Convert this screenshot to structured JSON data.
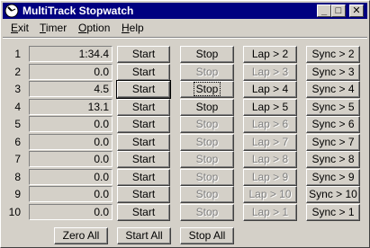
{
  "window": {
    "title": "MultiTrack Stopwatch"
  },
  "title_buttons": {
    "minimize": "_",
    "maximize": "□",
    "close": "✕"
  },
  "menu": [
    {
      "mnemonic": "E",
      "rest": "xit"
    },
    {
      "mnemonic": "T",
      "rest": "imer"
    },
    {
      "mnemonic": "O",
      "rest": "ption"
    },
    {
      "mnemonic": "H",
      "rest": "elp"
    }
  ],
  "rows": [
    {
      "num": "1",
      "time": "1:34.4",
      "start": "Start",
      "stop": "Stop",
      "lap": "Lap > 2",
      "sync": "Sync > 2",
      "start_enabled": true,
      "stop_enabled": true,
      "lap_enabled": true,
      "sync_enabled": true
    },
    {
      "num": "2",
      "time": "0.0",
      "start": "Start",
      "stop": "Stop",
      "lap": "Lap > 3",
      "sync": "Sync > 3",
      "start_enabled": true,
      "stop_enabled": false,
      "lap_enabled": false,
      "sync_enabled": true
    },
    {
      "num": "3",
      "time": "4.5",
      "start": "Start",
      "stop": "Stop",
      "lap": "Lap > 4",
      "sync": "Sync > 4",
      "start_enabled": true,
      "stop_enabled": true,
      "lap_enabled": true,
      "sync_enabled": true
    },
    {
      "num": "4",
      "time": "13.1",
      "start": "Start",
      "stop": "Stop",
      "lap": "Lap > 5",
      "sync": "Sync > 5",
      "start_enabled": true,
      "stop_enabled": true,
      "lap_enabled": true,
      "sync_enabled": true
    },
    {
      "num": "5",
      "time": "0.0",
      "start": "Start",
      "stop": "Stop",
      "lap": "Lap > 6",
      "sync": "Sync > 6",
      "start_enabled": true,
      "stop_enabled": false,
      "lap_enabled": false,
      "sync_enabled": true
    },
    {
      "num": "6",
      "time": "0.0",
      "start": "Start",
      "stop": "Stop",
      "lap": "Lap > 7",
      "sync": "Sync > 7",
      "start_enabled": true,
      "stop_enabled": false,
      "lap_enabled": false,
      "sync_enabled": true
    },
    {
      "num": "7",
      "time": "0.0",
      "start": "Start",
      "stop": "Stop",
      "lap": "Lap > 8",
      "sync": "Sync > 8",
      "start_enabled": true,
      "stop_enabled": false,
      "lap_enabled": false,
      "sync_enabled": true
    },
    {
      "num": "8",
      "time": "0.0",
      "start": "Start",
      "stop": "Stop",
      "lap": "Lap > 9",
      "sync": "Sync > 9",
      "start_enabled": true,
      "stop_enabled": false,
      "lap_enabled": false,
      "sync_enabled": true
    },
    {
      "num": "9",
      "time": "0.0",
      "start": "Start",
      "stop": "Stop",
      "lap": "Lap > 10",
      "sync": "Sync > 10",
      "start_enabled": true,
      "stop_enabled": false,
      "lap_enabled": false,
      "sync_enabled": true
    },
    {
      "num": "10",
      "time": "0.0",
      "start": "Start",
      "stop": "Stop",
      "lap": "Lap > 1",
      "sync": "Sync > 1",
      "start_enabled": true,
      "stop_enabled": false,
      "lap_enabled": false,
      "sync_enabled": true
    }
  ],
  "focus": {
    "default_row": 3,
    "focused_stop_row": 3
  },
  "bottom": {
    "zero_all": "Zero All",
    "start_all": "Start All",
    "stop_all": "Stop All"
  },
  "colors": {
    "titlebar": "#000080",
    "face": "#d4d0c8",
    "disabled_text": "#808080"
  },
  "icons": {
    "app": "stopwatch-icon"
  }
}
